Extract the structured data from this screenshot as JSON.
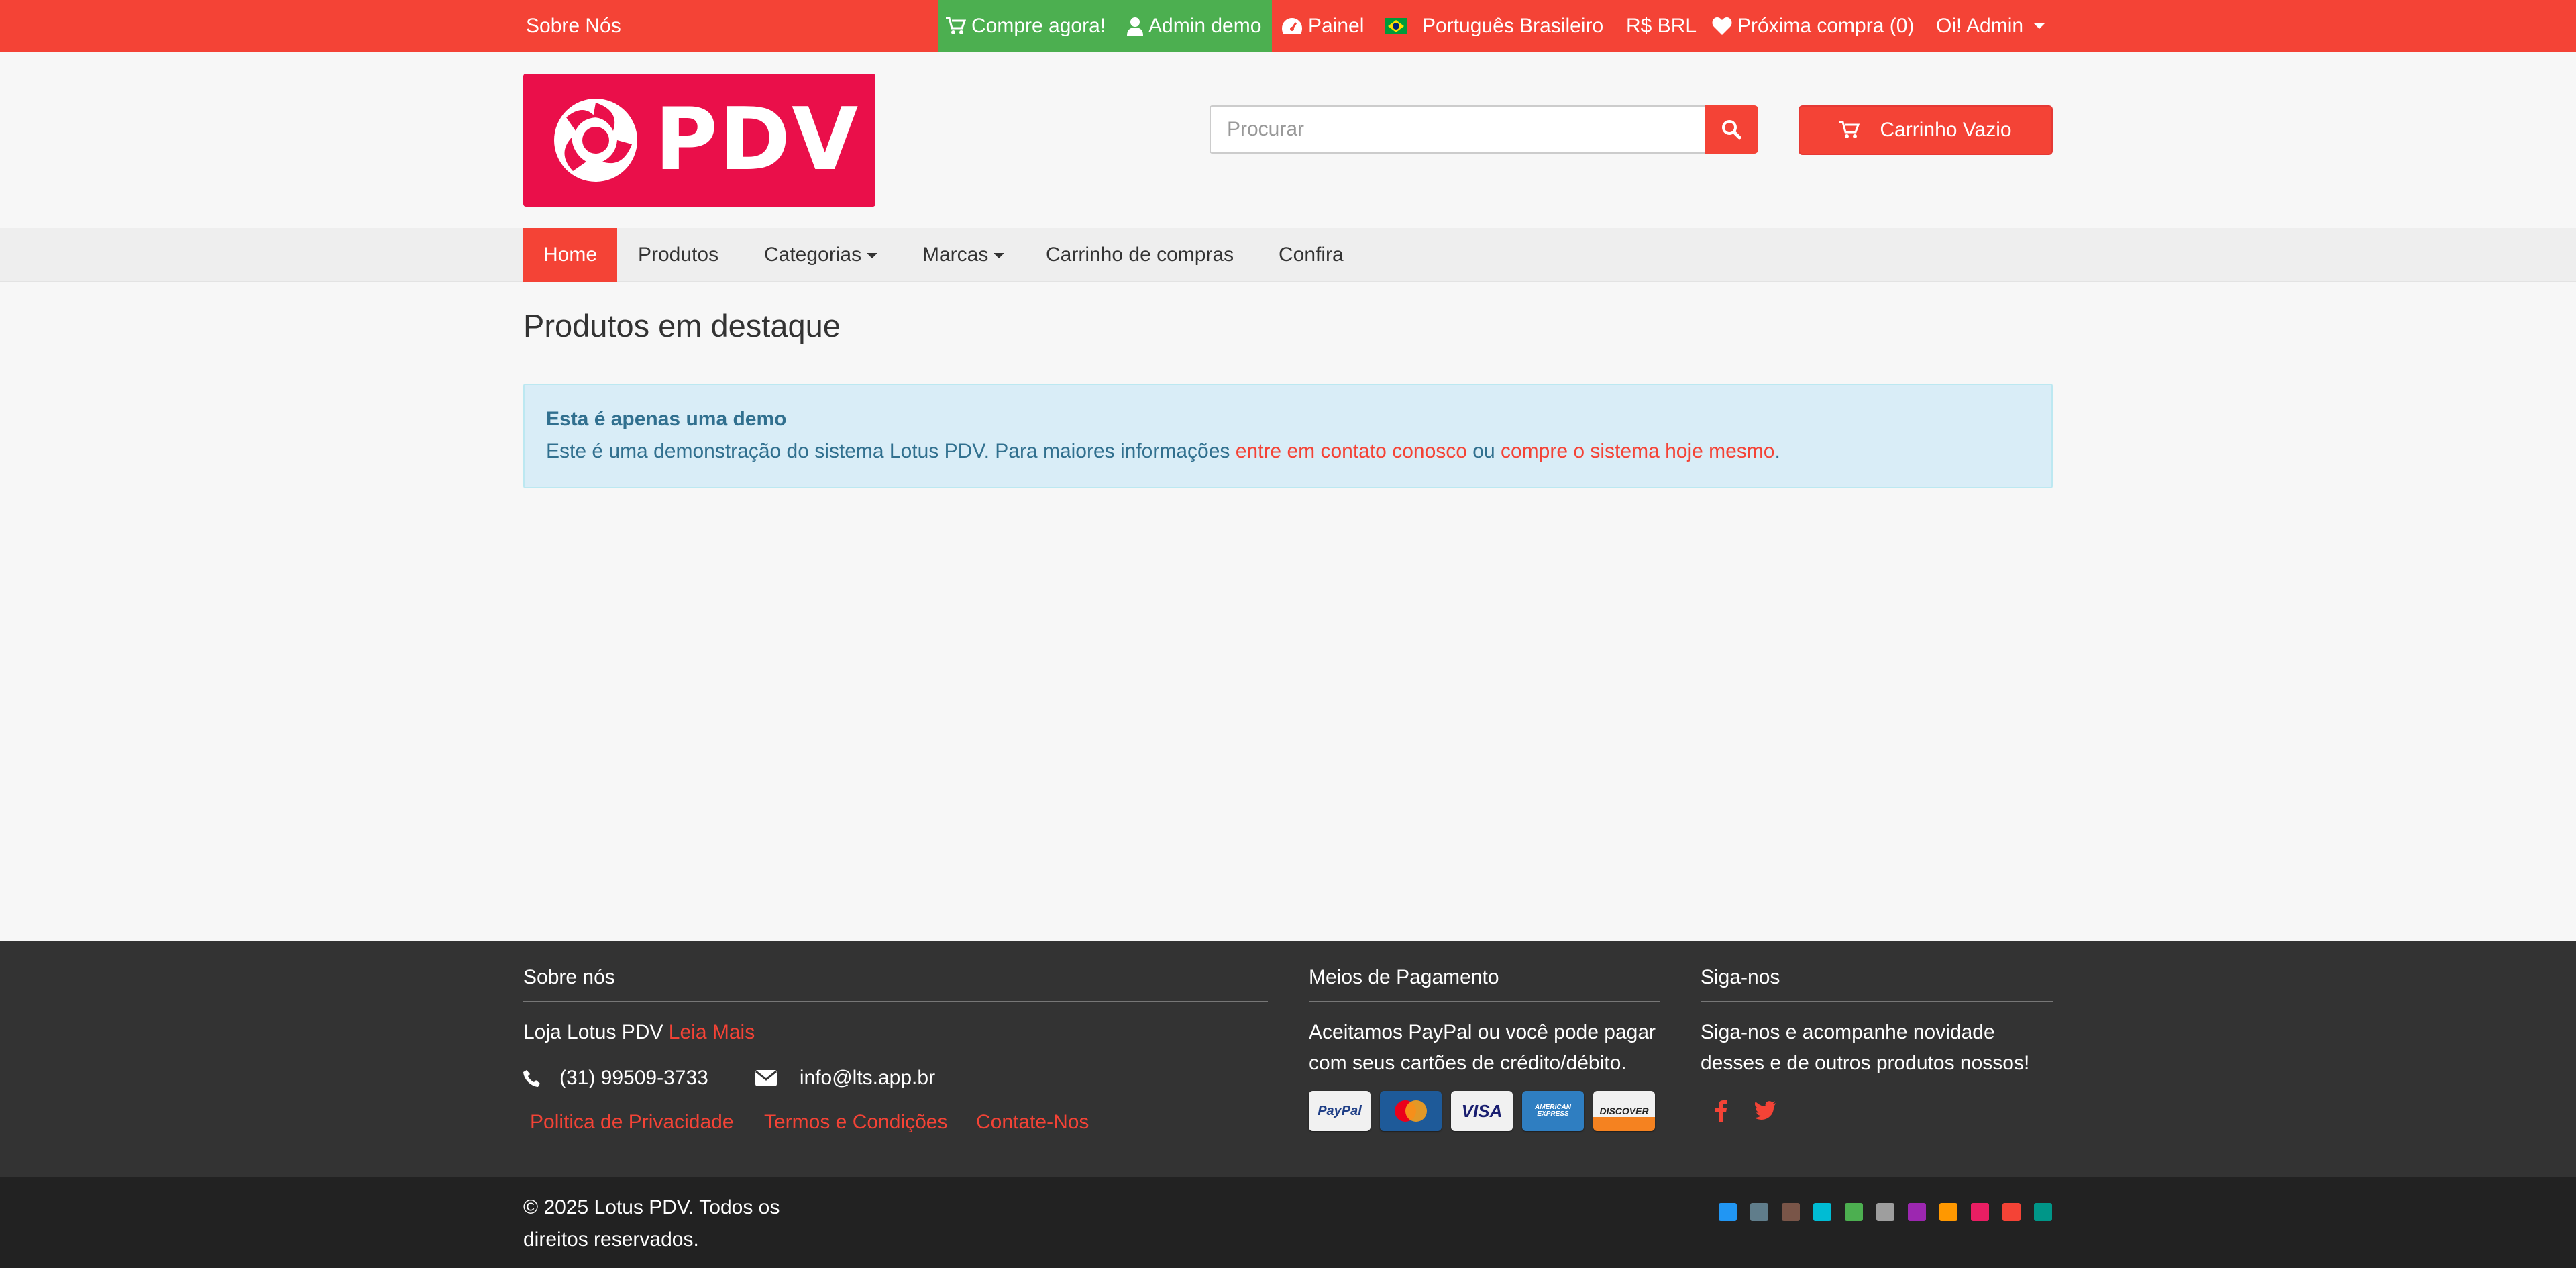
{
  "topbar": {
    "about": "Sobre Nós",
    "buy_now": "Compre agora!",
    "admin_demo": "Admin demo",
    "panel": "Painel",
    "language": "Português Brasileiro",
    "currency": "R$ BRL",
    "wishlist": "Próxima compra (0)",
    "user": "Oi! Admin"
  },
  "header": {
    "logo_text": "PDV",
    "search_placeholder": "Procurar",
    "cart_label": "Carrinho Vazio"
  },
  "nav": {
    "items": [
      {
        "label": "Home",
        "active": true
      },
      {
        "label": "Produtos"
      },
      {
        "label": "Categorias",
        "dropdown": true
      },
      {
        "label": "Marcas",
        "dropdown": true
      },
      {
        "label": "Carrinho de compras"
      },
      {
        "label": "Confira"
      }
    ]
  },
  "main": {
    "title": "Produtos em destaque",
    "alert": {
      "title": "Esta é apenas uma demo",
      "text_before": "Este é uma demonstração do sistema Lotus PDV. Para maiores informações ",
      "link1": "entre em contato conosco",
      "text_middle": " ou ",
      "link2": "compre o sistema hoje mesmo",
      "text_after": "."
    }
  },
  "footer": {
    "about": {
      "title": "Sobre nós",
      "store": "Loja Lotus PDV ",
      "read_more": "Leia Mais",
      "phone": "(31) 99509-3733",
      "email": "info@lts.app.br",
      "links": [
        "Politica de Privacidade",
        "Termos e Condições",
        "Contate-Nos"
      ]
    },
    "payment": {
      "title": "Meios de Pagamento",
      "text": "Aceitamos PayPal ou você pode pagar com seus cartões de crédito/débito.",
      "cards": [
        "PayPal",
        "MasterCard",
        "VISA",
        "AMERICAN EXPRESS",
        "DISCOVER"
      ]
    },
    "follow": {
      "title": "Siga-nos",
      "text": "Siga-nos e acompanhe novidade desses e de outros produtos nossos!",
      "icons": [
        "facebook-icon",
        "twitter-icon"
      ]
    },
    "copyright": "© 2025 Lotus PDV. Todos os direitos reservados.",
    "theme_colors": [
      "#2196f3",
      "#607d8b",
      "#795548",
      "#00bcd4",
      "#4caf50",
      "#9e9e9e",
      "#9c27b0",
      "#ff9800",
      "#e91e63",
      "#f44336",
      "#009688"
    ]
  },
  "colors": {
    "primary": "#f44336",
    "green": "#4caf50",
    "logo_bg": "#ea0f4a",
    "alert_bg": "#d9edf7",
    "alert_text": "#31708f"
  }
}
